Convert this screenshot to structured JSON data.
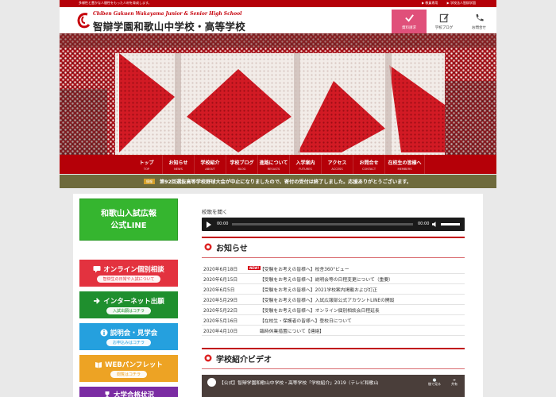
{
  "topbar": {
    "tagline": "多様性と豊かな人間性をもった人材を育成します。",
    "links": [
      "▶ 教員専用",
      "▶ 学校法人智辯学園"
    ]
  },
  "header": {
    "logo_en": "Chiben Gakuen Wakayama Junior & Senior High School",
    "logo_ja": "智辯学園和歌山中学校・高等学校",
    "buttons": [
      {
        "label": "資料請求",
        "icon": "check-icon"
      },
      {
        "label": "学校ブログ",
        "icon": "pencil-icon"
      },
      {
        "label": "お問合せ",
        "icon": "phone-icon"
      }
    ]
  },
  "nav": [
    {
      "ja": "トップ",
      "en": "TOP"
    },
    {
      "ja": "お知らせ",
      "en": "NEWS"
    },
    {
      "ja": "学校紹介",
      "en": "ABOUT"
    },
    {
      "ja": "学校ブログ",
      "en": "BLOG"
    },
    {
      "ja": "進路について",
      "en": "RESULTS"
    },
    {
      "ja": "入学案内",
      "en": "FUTURES"
    },
    {
      "ja": "アクセス",
      "en": "ACCESS"
    },
    {
      "ja": "お問合せ",
      "en": "CONTACT"
    },
    {
      "ja": "在校生の皆様へ",
      "en": "MEMBERS"
    }
  ],
  "ticker": {
    "badge": "情報",
    "message": "第92回選抜高等学校野球大会が中止になりましたので、寄付の受付は終了しました。応援ありがとうございます。"
  },
  "sidebar": {
    "line_banner": [
      "和歌山入試広報",
      "公式LINE"
    ],
    "buttons": [
      {
        "title": "オンライン個別相談",
        "sub": "智辯生の日常や入試について",
        "icon": "chat-icon"
      },
      {
        "title": "インターネット出願",
        "sub": "入試出願はコチラ",
        "icon": "arrow-icon"
      },
      {
        "title": "説明会・見学会",
        "sub": "お申込みはコチラ",
        "icon": "info-icon"
      },
      {
        "title": "WEBパンフレット",
        "sub": "閲覧はコチラ",
        "icon": "book-icon"
      },
      {
        "title": "大学合格状況",
        "sub": "",
        "icon": "trophy-icon"
      }
    ]
  },
  "radio": {
    "label": "校歌を聞く",
    "time_current": "00:00",
    "time_total": "00:00"
  },
  "news": {
    "title": "お知らせ",
    "new_badge": "NEW!",
    "items": [
      {
        "date": "2020年6月18日",
        "text": "【受験をお考えの皆様へ】校舎360°ビュー",
        "is_new": true
      },
      {
        "date": "2020年6月15日",
        "text": "【受験をお考えの皆様へ】説明会等の日程変更について（重要）",
        "is_new": false
      },
      {
        "date": "2020年6月5日",
        "text": "【受験をお考えの皆様へ】2021学校案内掲載および訂正",
        "is_new": false
      },
      {
        "date": "2020年5月29日",
        "text": "【受験をお考えの皆様へ】入試広報部公式アカウントLINEの開設",
        "is_new": false
      },
      {
        "date": "2020年5月22日",
        "text": "【受験をお考えの皆様へ】オンライン個別相談会日程延長",
        "is_new": false
      },
      {
        "date": "2020年5月16日",
        "text": "【在校生・保護者の皆様へ】登校日について",
        "is_new": false
      },
      {
        "date": "2020年4月10日",
        "text": "臨時休業措置について【連絡】",
        "is_new": false
      }
    ]
  },
  "video": {
    "section_title": "学校紹介ビデオ",
    "title": "【公式】智辯学園和歌山中学校・高等学校「学校紹介」2019（テレビ和歌山",
    "later": "後で見る",
    "share": "共有"
  },
  "colors": {
    "brand_red": "#b50008",
    "line_green": "#35b52f",
    "pink_active": "#e0507a"
  }
}
